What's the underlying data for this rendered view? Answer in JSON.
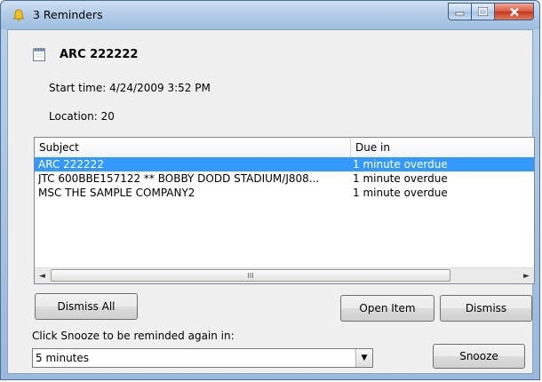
{
  "window": {
    "title": "3 Reminders",
    "colors": {
      "selection": "#3399ff",
      "close_button": "#c8381c"
    }
  },
  "item": {
    "title": "ARC 222222",
    "start_time": "Start time: 4/24/2009 3:52 PM",
    "location": "Location:   20",
    "icon": "appointment-icon"
  },
  "list": {
    "columns": [
      "Subject",
      "Due in"
    ],
    "rows": [
      {
        "subject": "ARC  222222",
        "due": "1 minute overdue",
        "selected": true
      },
      {
        "subject": "JTC  600BBE157122 ** BOBBY DODD STADIUM/J808...",
        "due": "1 minute overdue",
        "selected": false
      },
      {
        "subject": "MSC  THE SAMPLE COMPANY2",
        "due": "1 minute overdue",
        "selected": false
      }
    ],
    "scroll_left_icon": "◄",
    "scroll_right_icon": "►",
    "scroll_grip": "III"
  },
  "buttons": {
    "dismiss_all": "Dismiss All",
    "open_item": "Open Item",
    "dismiss": "Dismiss",
    "snooze": "Snooze"
  },
  "snooze": {
    "label": "Click Snooze to be reminded again in:",
    "selected": "5 minutes",
    "dropdown_icon": "▼"
  }
}
